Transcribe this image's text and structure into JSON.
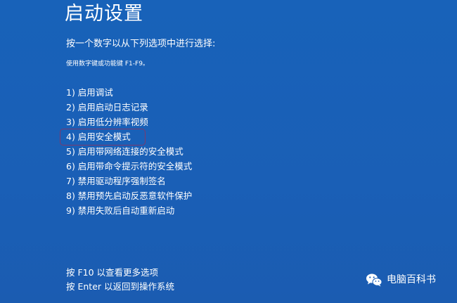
{
  "screen": {
    "title": "启动设置",
    "instruction": "按一个数字以从下列选项中进行选择:",
    "hint": "使用数字键或功能键 F1-F9。",
    "options": [
      {
        "label": "1) 启用调试"
      },
      {
        "label": "2) 启用启动日志记录"
      },
      {
        "label": "3) 启用低分辨率视频"
      },
      {
        "label": "4) 启用安全模式"
      },
      {
        "label": "5) 启用带网络连接的安全模式"
      },
      {
        "label": "6) 启用带命令提示符的安全模式"
      },
      {
        "label": "7) 禁用驱动程序强制签名"
      },
      {
        "label": "8) 禁用预先启动反恶意软件保护"
      },
      {
        "label": "9) 禁用失败后自动重新启动"
      }
    ],
    "highlighted_option_index": 3,
    "footer": [
      {
        "label": "按 F10 以查看更多选项"
      },
      {
        "label": "按 Enter 以返回到操作系统"
      }
    ]
  },
  "watermark": {
    "text": "电脑百科书",
    "icon": "wechat-icon"
  },
  "colors": {
    "background": "#1a5fb8",
    "text": "#ffffff",
    "highlight_border": "#7b3a6e"
  }
}
